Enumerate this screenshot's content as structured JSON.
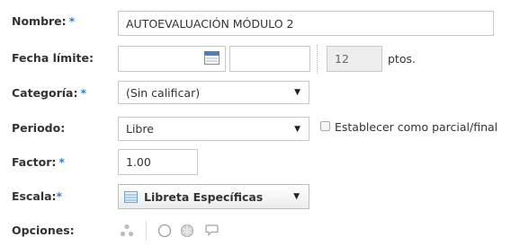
{
  "form": {
    "nombre": {
      "label": "Nombre:",
      "required": "*",
      "value": "AUTOEVALUACIÓN MÓDULO 2"
    },
    "fecha": {
      "label": "Fecha límite:",
      "date_value": "",
      "time_value": "",
      "points_value": "12",
      "points_unit": "ptos."
    },
    "categoria": {
      "label": "Categoría:",
      "required": "*",
      "selected": "(Sin calificar)"
    },
    "periodo": {
      "label": "Periodo:",
      "selected": "Libre",
      "checkbox_label": "Establecer como parcial/final",
      "checkbox_checked": false
    },
    "factor": {
      "label": "Factor:",
      "required": "*",
      "value": "1.00"
    },
    "escala": {
      "label": "Escala:",
      "required": "*",
      "selected": "Libreta Específicas"
    },
    "opciones": {
      "label": "Opciones:"
    }
  },
  "colors": {
    "required_star": "#2f7fd8",
    "disabled_bg": "#eeeeee",
    "border": "#c8c8c8"
  },
  "icons": [
    "calendar-icon",
    "scale-list-icon",
    "dots-icon",
    "circle-radio-icon",
    "ball-icon",
    "comment-icon"
  ]
}
